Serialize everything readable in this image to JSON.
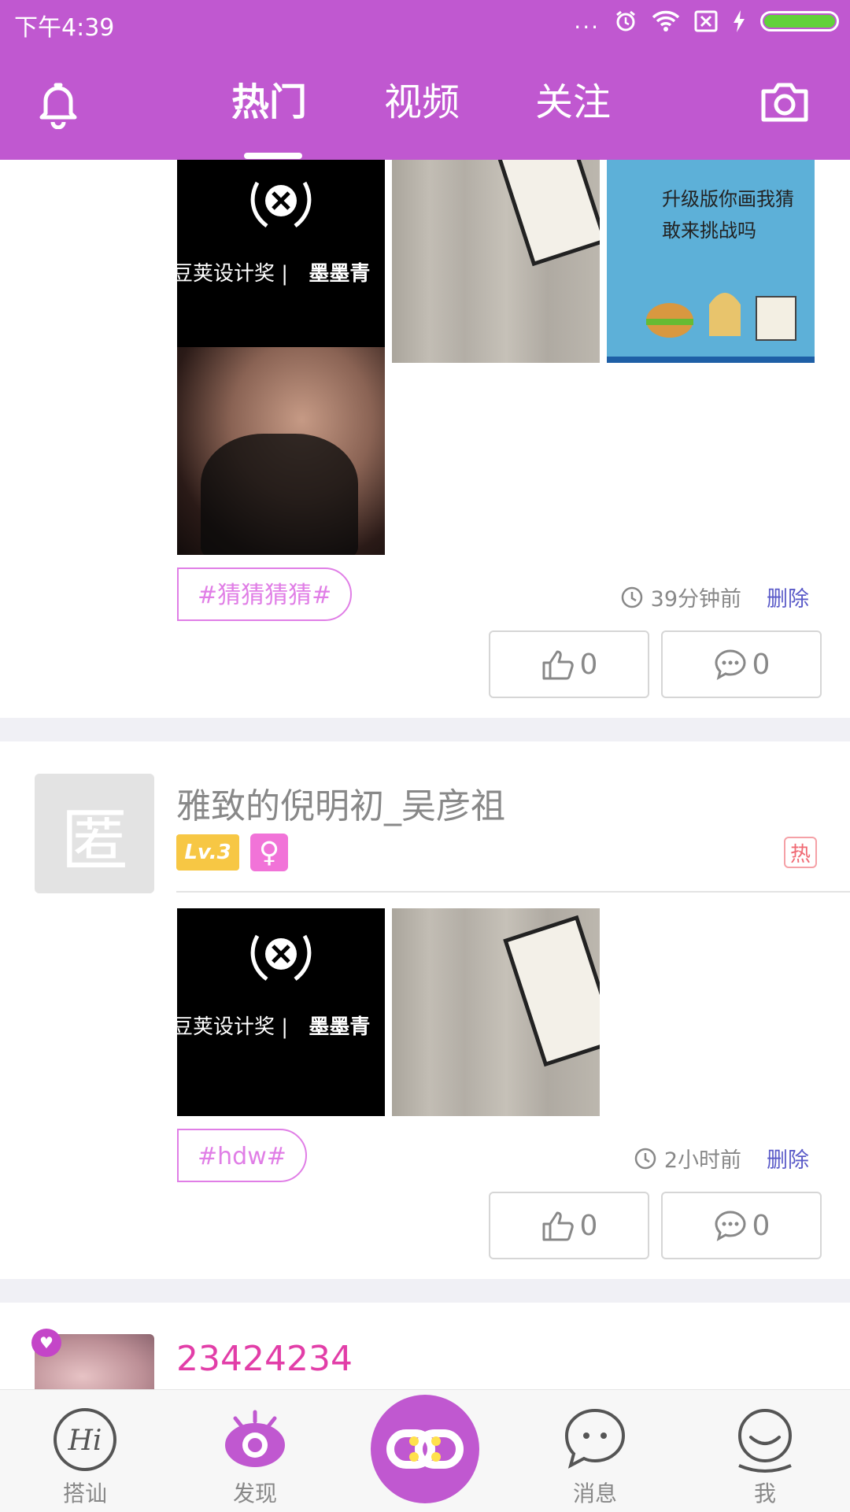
{
  "status_bar": {
    "time": "下午4:39",
    "dots": "..."
  },
  "header": {
    "tabs": [
      {
        "label": "热门",
        "active": true
      },
      {
        "label": "视频",
        "active": false
      },
      {
        "label": "关注",
        "active": false
      }
    ],
    "bell_icon": "bell-icon",
    "camera_icon": "camera-icon"
  },
  "posts": [
    {
      "images": [
        {
          "kind": "award-logo",
          "caption_a": "豆荚设计奖",
          "caption_sep": "|",
          "caption_b": "墨墨青"
        },
        {
          "kind": "wood-desk-book"
        },
        {
          "kind": "cartoon",
          "line1": "升级版你画我猜",
          "line2": "敢来挑战吗"
        },
        {
          "kind": "photo"
        }
      ],
      "tag": "#猜猜猜猜#",
      "time": "39分钟前",
      "delete_label": "删除",
      "likes": "0",
      "comments": "0"
    },
    {
      "avatar_glyph": "匿",
      "username": "雅致的倪明初_吴彦祖",
      "level": "Lv.3",
      "gender_symbol": "♀",
      "hot_badge": "热",
      "images": [
        {
          "kind": "award-logo",
          "caption_a": "豆荚设计奖",
          "caption_sep": "|",
          "caption_b": "墨墨青"
        },
        {
          "kind": "wood-desk-book"
        }
      ],
      "tag": "#hdw#",
      "time": "2小时前",
      "delete_label": "删除",
      "likes": "0",
      "comments": "0"
    },
    {
      "username": "23424234",
      "heart_icon": "heart-icon"
    }
  ],
  "bottom_nav": {
    "items": [
      {
        "label": "搭讪",
        "icon": "hi-icon",
        "glyph": "Hi"
      },
      {
        "label": "发现",
        "icon": "eye-icon"
      },
      {
        "label": "",
        "icon": "link-icon"
      },
      {
        "label": "消息",
        "icon": "chat-icon"
      },
      {
        "label": "我",
        "icon": "user-icon"
      }
    ]
  },
  "colors": {
    "brand": "#c058d0",
    "tag": "#e07ee6",
    "link": "#5a5ac8",
    "accent_name": "#e23ea8"
  }
}
